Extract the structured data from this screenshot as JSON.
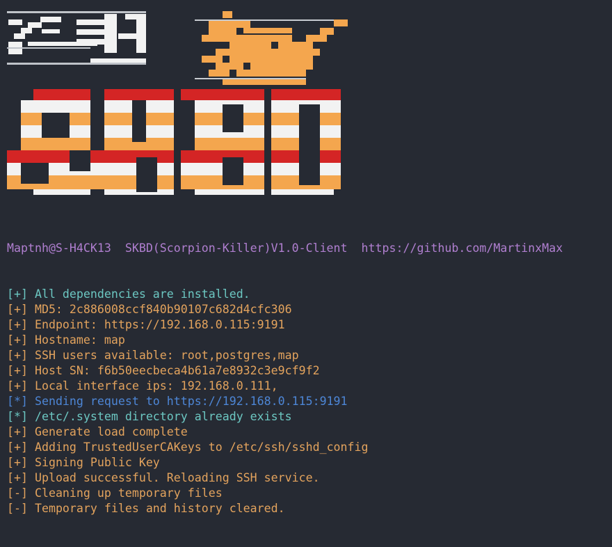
{
  "colors": {
    "background": "#262a33",
    "purple": "#b07fd0",
    "teal": "#6cc7c2",
    "orange": "#e3a35d",
    "blue": "#4d86d6",
    "red": "#d42525",
    "white": "#f2f2f2"
  },
  "banner": {
    "logo_text": "SKBD",
    "small_logo": "SKBD"
  },
  "header": {
    "user": "Maptnh@S-H4CK13",
    "app": "SKBD(Scorpion-Killer)V1.0-Client",
    "url": "https://github.com/MartinxMax"
  },
  "log": [
    {
      "prefix": "[+]",
      "text": " All dependencies are installed.",
      "color": "teal"
    },
    {
      "prefix": "[+]",
      "text": " MD5: 2c886008ccf840b90107c682d4cfc306",
      "color": "orange"
    },
    {
      "prefix": "[+]",
      "text": " Endpoint: https://192.168.0.115:9191",
      "color": "orange"
    },
    {
      "prefix": "[+]",
      "text": " Hostname: map",
      "color": "orange"
    },
    {
      "prefix": "[+]",
      "text": " SSH users available: root,postgres,map",
      "color": "orange"
    },
    {
      "prefix": "[+]",
      "text": " Host SN: f6b50eecbeca4b61a7e8932c3e9cf9f2",
      "color": "orange"
    },
    {
      "prefix": "[+]",
      "text": " Local interface ips: 192.168.0.111,",
      "color": "orange"
    },
    {
      "prefix": "[*]",
      "text": " Sending request to https://192.168.0.115:9191",
      "color": "blue"
    },
    {
      "prefix": "[*]",
      "text": " /etc/.system directory already exists",
      "color": "teal"
    },
    {
      "prefix": "[+]",
      "text": " Generate load complete",
      "color": "orange"
    },
    {
      "prefix": "[+]",
      "text": " Adding TrustedUserCAKeys to /etc/ssh/sshd_config",
      "color": "orange"
    },
    {
      "prefix": "[+]",
      "text": " Signing Public Key",
      "color": "orange"
    },
    {
      "prefix": "[+]",
      "text": " Upload successful. Reloading SSH service.",
      "color": "orange"
    },
    {
      "prefix": "[-]",
      "text": " Cleaning up temporary files",
      "color": "orange"
    },
    {
      "prefix": "[-]",
      "text": " Temporary files and history cleared.",
      "color": "orange"
    }
  ]
}
